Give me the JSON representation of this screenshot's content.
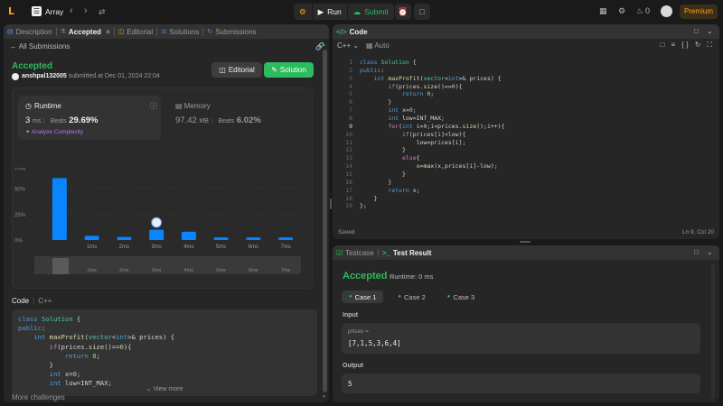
{
  "topbar": {
    "problem_title": "Array",
    "run_label": "Run",
    "submit_label": "Submit",
    "streak_count": "0",
    "premium_label": "Premium"
  },
  "left_tabs": [
    {
      "label": "Description"
    },
    {
      "label": "Accepted"
    },
    {
      "label": "Editorial"
    },
    {
      "label": "Solutions"
    },
    {
      "label": "Submissions"
    }
  ],
  "submission": {
    "back_label": "All Submissions",
    "status": "Accepted",
    "username": "anshpal132005",
    "submitted_text": "submitted at Dec 01, 2024 22:04",
    "editorial_btn": "Editorial",
    "solution_btn": "Solution"
  },
  "runtime": {
    "label": "Runtime",
    "value": "3",
    "unit": "ms",
    "beats_label": "Beats",
    "beats_pct": "29.69%",
    "analyze_label": "Analyze Complexity"
  },
  "memory": {
    "label": "Memory",
    "value": "97.42",
    "unit": "MB",
    "beats_label": "Beats",
    "beats_pct": "6.02%"
  },
  "chart_data": {
    "type": "bar",
    "y_ticks": [
      "70%",
      "50%",
      "25%",
      "0%"
    ],
    "ylim": [
      0,
      70
    ],
    "categories": [
      "",
      "1ms",
      "2ms",
      "3ms",
      "4ms",
      "5ms",
      "6ms",
      "7ms"
    ],
    "values": [
      60,
      4,
      3,
      10,
      8,
      2.5,
      2.5,
      2.5
    ],
    "highlight_index": 3,
    "colors": {
      "bar": "#0a84ff",
      "grid": "#3a3a3a"
    }
  },
  "code_preview": {
    "label": "Code",
    "language": "C++",
    "lines": [
      "class Solution {",
      "public:",
      "    int maxProfit(vector<int>& prices) {",
      "        if(prices.size()==0){",
      "            return 0;",
      "        }",
      "        int x=0;",
      "        int low=INT_MAX;"
    ],
    "view_more": "View more"
  },
  "more_challenges": "More challenges",
  "code_panel": {
    "title": "Code",
    "language": "C++",
    "auto_label": "Auto",
    "saved": "Saved",
    "cursor": "Ln 9, Col 20",
    "current_line": 9,
    "lines": [
      "class Solution {",
      "public:",
      "    int maxProfit(vector<int>& prices) {",
      "        if(prices.size()==0){",
      "            return 0;",
      "        }",
      "        int x=0;",
      "        int low=INT_MAX;",
      "        for(int i=0;i<prices.size();i++){",
      "            if(prices[i]<low){",
      "                low=prices[i];",
      "            }",
      "            else{",
      "                x=max(x,prices[i]-low);",
      "            }",
      "        }",
      "        return x;",
      "    }",
      "};"
    ]
  },
  "test_panel": {
    "testcase_tab": "Testcase",
    "result_tab": "Test Result",
    "status": "Accepted",
    "runtime_text": "Runtime: 0 ms",
    "cases": [
      "Case 1",
      "Case 2",
      "Case 3"
    ],
    "input_label": "Input",
    "input_key": "prices =",
    "input_value": "[7,1,5,3,6,4]",
    "output_label": "Output",
    "output_value": "5"
  }
}
